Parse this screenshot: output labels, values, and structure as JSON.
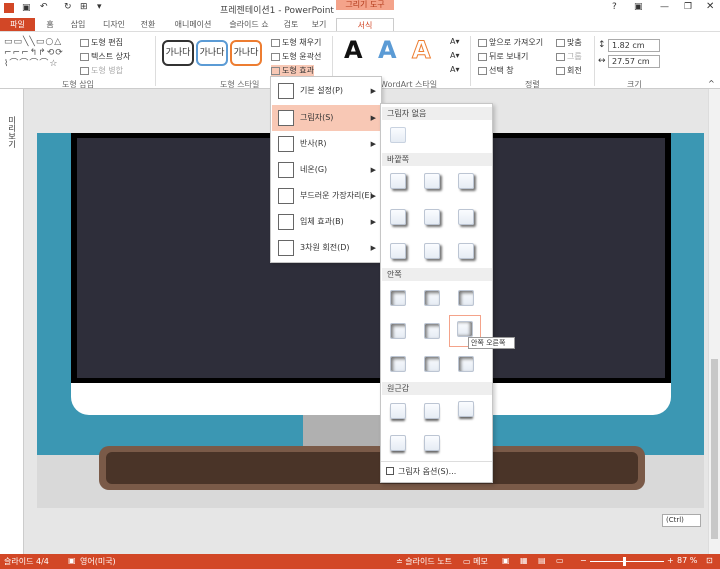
{
  "window": {
    "title": "프레젠테이션1 - PowerPoint",
    "context_group": "그리기 도구"
  },
  "tabs": [
    "파일",
    "홈",
    "삽입",
    "디자인",
    "전환",
    "애니메이션",
    "슬라이드 쇼",
    "검토",
    "보기",
    "서식"
  ],
  "ribbon": {
    "insert_shapes": {
      "edit_shape": "도형 편집",
      "text_box": "텍스트 상자",
      "merge_shapes": "도형 병합",
      "label": "도형 삽입"
    },
    "shape_styles": {
      "swatches": [
        "가나다",
        "가나다",
        "가나다"
      ],
      "fill": "도형 채우기",
      "outline": "도형 윤곽선",
      "effects": "도형 효과",
      "label": "도형 스타일"
    },
    "wordart": {
      "label": "WordArt 스타일"
    },
    "arrange": {
      "bring_forward": "앞으로 가져오기",
      "send_backward": "뒤로 보내기",
      "selection_pane": "선택 창",
      "align": "맞춤",
      "group": "그룹",
      "rotate": "회전",
      "label": "정렬"
    },
    "size": {
      "height": "1.82 cm",
      "width": "27.57 cm",
      "label": "크기"
    }
  },
  "left_pane_label": "미리 보기",
  "effects_menu": {
    "items": [
      "기본 설정(P)",
      "그림자(S)",
      "반사(R)",
      "네온(G)",
      "부드러운 가장자리(E)",
      "입체 효과(B)",
      "3차원 회전(D)"
    ],
    "active_index": 1
  },
  "shadow_submenu": {
    "no_shadow": "그림자 없음",
    "outer": "바깥쪽",
    "inner": "안쪽",
    "perspective": "원근감",
    "options": "그림자 옵션(S)...",
    "tooltip": "안쪽 오른쪽"
  },
  "paste_ctrl": "(Ctrl)",
  "status": {
    "slide": "슬라이드 4/4",
    "language": "영어(미국)",
    "notes": "슬라이드 노트",
    "memo": "메모",
    "zoom": "87 %"
  },
  "colors": {
    "accent": "#d24726",
    "wall": "#3b97b3",
    "selection": "#f8c8b5"
  }
}
